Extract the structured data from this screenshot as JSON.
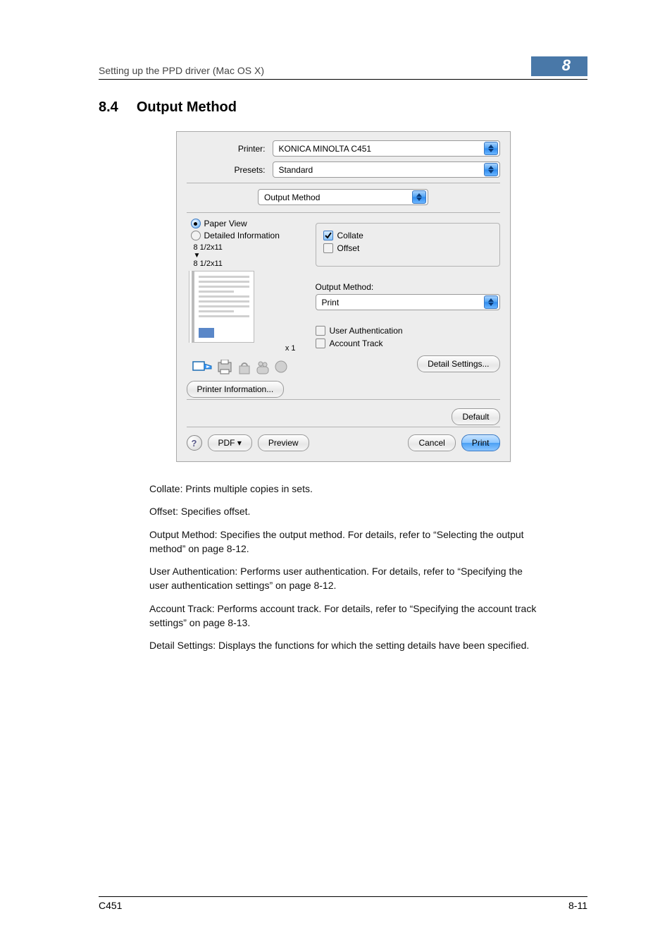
{
  "header": {
    "breadcrumb": "Setting up the PPD driver (Mac OS X)",
    "chapter": "8"
  },
  "section": {
    "number": "8.4",
    "title": "Output Method"
  },
  "dialog": {
    "printer_label": "Printer:",
    "printer_value": "KONICA MINOLTA C451",
    "presets_label": "Presets:",
    "presets_value": "Standard",
    "panel_value": "Output Method",
    "radio_paper_view": "Paper View",
    "radio_detailed_info": "Detailed Information",
    "size_top": "8 1/2x11",
    "size_bottom": "8 1/2x11",
    "xn": "x 1",
    "printer_info_btn": "Printer Information...",
    "collate_label": "Collate",
    "offset_label": "Offset",
    "output_method_label": "Output Method:",
    "output_method_value": "Print",
    "user_auth_label": "User Authentication",
    "account_track_label": "Account Track",
    "detail_settings_btn": "Detail Settings...",
    "default_btn": "Default",
    "help": "?",
    "pdf_btn": "PDF ▾",
    "preview_btn": "Preview",
    "cancel_btn": "Cancel",
    "print_btn": "Print"
  },
  "body": {
    "p1": "Collate: Prints multiple copies in sets.",
    "p2": "Offset: Specifies offset.",
    "p3": "Output Method: Specifies the output method. For details, refer to “Selecting the output method” on page 8-12.",
    "p4": "User Authentication: Performs user authentication. For details, refer to “Specifying the user authentication settings” on page 8-12.",
    "p5": "Account Track: Performs account track. For details, refer to “Specifying the account track settings” on page 8-13.",
    "p6": "Detail Settings: Displays the functions for which the setting details have been specified."
  },
  "footer": {
    "model": "C451",
    "pageno": "8-11"
  }
}
